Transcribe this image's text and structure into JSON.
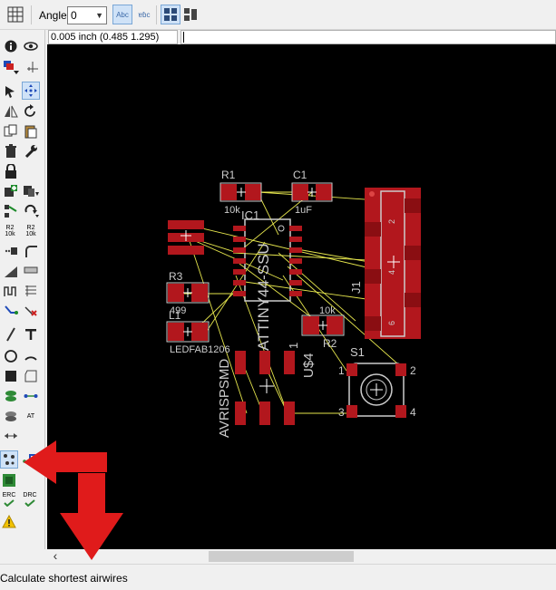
{
  "toolbar": {
    "angle_label": "Angle:",
    "angle_value": "0",
    "mirror_label": "Abc",
    "spin_label": "ɐɓc"
  },
  "coords": {
    "readout": "0.005 inch (0.485 1.295)",
    "command_value": ""
  },
  "sidebar": {
    "tools": [
      "info-icon",
      "show-icon",
      "layer-display-icon",
      "mark-icon",
      "move-icon",
      "group-icon",
      "mirror-icon",
      "rotate-icon",
      "copy-icon",
      "paste-icon",
      "delete-icon",
      "wrench-icon",
      "lock-icon",
      "add-icon",
      "replace-icon",
      "change-icon",
      "split-icon",
      "optimize-icon",
      "value-icon",
      "name-icon",
      "smash-icon",
      "miter-icon",
      "route-icon",
      "ripup-icon",
      "meander-icon",
      "split-trace-icon",
      "fanout-icon",
      "lines-icon",
      "wire-icon",
      "text-icon",
      "circle-icon",
      "arc-icon",
      "rect-icon",
      "polygon-icon",
      "via-icon",
      "signal-icon",
      "hole-icon",
      "attribute-icon",
      "dimension-icon",
      "ratsnest-icon",
      "autorouter-icon",
      "erc-icon",
      "drc-icon",
      "errors-icon"
    ],
    "erc_label": "ERC",
    "drc_label": "DRC",
    "r2_label_a": "R2",
    "r2_label_b": "R2",
    "r2_val_a": "10k",
    "r2_val_b": "10k",
    "at_label": "AT"
  },
  "board": {
    "labels": {
      "r1": "R1",
      "r1_val": "10k",
      "c1": "C1",
      "c1_val": "1uF",
      "ic1": "IC1",
      "ic1_val": "ATTINY44-SSU",
      "r3": "R3",
      "r3_val": "499",
      "l1": "L1",
      "l1_val": "LEDFAB1206",
      "r2": "R2",
      "r2_val": "10k",
      "j1": "J1",
      "u4": "U$4",
      "u4_pin": "1",
      "avr": "AVRISPSMD",
      "s1": "S1",
      "s1_p1": "1",
      "s1_p2": "2",
      "s1_p3": "3",
      "s1_p4": "4",
      "j1_p2": "2",
      "j1_p4": "4",
      "j1_p6": "6"
    },
    "colors": {
      "pad": "#b2171d",
      "airwire": "#e6e64d",
      "silk": "#cccccc",
      "background": "#000000"
    }
  },
  "status": {
    "text": "Calculate shortest airwires"
  },
  "annotations": {
    "arrow_color": "#e01b1b"
  }
}
